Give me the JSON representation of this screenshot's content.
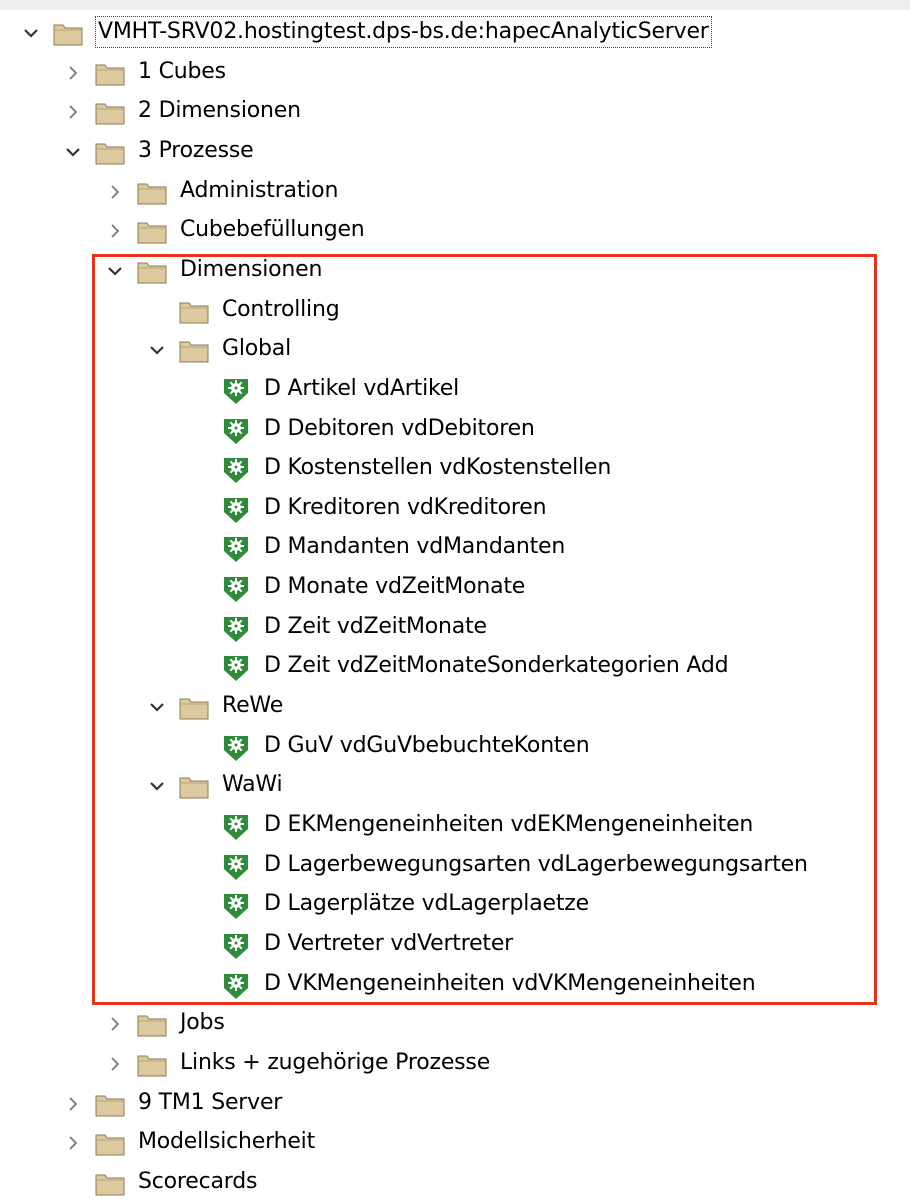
{
  "colors": {
    "highlight": "#e8321c",
    "folder": "#dcc9a0",
    "process": "#2e8b3a"
  },
  "tree": [
    {
      "label": "VMHT-SRV02.hostingtest.dps-bs.de:hapecAnalyticServer",
      "level": 0,
      "expander": "expanded",
      "icon": "folder-icon",
      "root": true
    },
    {
      "label": "1 Cubes",
      "level": 1,
      "expander": "collapsed",
      "icon": "folder-icon"
    },
    {
      "label": "2 Dimensionen",
      "level": 1,
      "expander": "collapsed",
      "icon": "folder-icon"
    },
    {
      "label": "3 Prozesse",
      "level": 1,
      "expander": "expanded",
      "icon": "folder-icon"
    },
    {
      "label": "Administration",
      "level": 2,
      "expander": "collapsed",
      "icon": "folder-icon"
    },
    {
      "label": "Cubebefüllungen",
      "level": 2,
      "expander": "collapsed",
      "icon": "folder-icon"
    },
    {
      "label": "Dimensionen",
      "level": 2,
      "expander": "expanded",
      "icon": "folder-icon"
    },
    {
      "label": "Controlling",
      "level": 3,
      "expander": "none",
      "icon": "folder-icon"
    },
    {
      "label": "Global",
      "level": 3,
      "expander": "expanded",
      "icon": "folder-icon"
    },
    {
      "label": "D Artikel vdArtikel",
      "level": 4,
      "expander": "none",
      "icon": "process-icon"
    },
    {
      "label": "D Debitoren vdDebitoren",
      "level": 4,
      "expander": "none",
      "icon": "process-icon"
    },
    {
      "label": "D Kostenstellen vdKostenstellen",
      "level": 4,
      "expander": "none",
      "icon": "process-icon"
    },
    {
      "label": "D Kreditoren vdKreditoren",
      "level": 4,
      "expander": "none",
      "icon": "process-icon"
    },
    {
      "label": "D Mandanten vdMandanten",
      "level": 4,
      "expander": "none",
      "icon": "process-icon"
    },
    {
      "label": "D Monate vdZeitMonate",
      "level": 4,
      "expander": "none",
      "icon": "process-icon"
    },
    {
      "label": "D Zeit vdZeitMonate",
      "level": 4,
      "expander": "none",
      "icon": "process-icon"
    },
    {
      "label": "D Zeit vdZeitMonateSonderkategorien Add",
      "level": 4,
      "expander": "none",
      "icon": "process-icon"
    },
    {
      "label": "ReWe",
      "level": 3,
      "expander": "expanded",
      "icon": "folder-icon"
    },
    {
      "label": "D GuV vdGuVbebuchteKonten",
      "level": 4,
      "expander": "none",
      "icon": "process-icon"
    },
    {
      "label": "WaWi",
      "level": 3,
      "expander": "expanded",
      "icon": "folder-icon"
    },
    {
      "label": "D EKMengeneinheiten vdEKMengeneinheiten",
      "level": 4,
      "expander": "none",
      "icon": "process-icon"
    },
    {
      "label": "D Lagerbewegungsarten vdLagerbewegungsarten",
      "level": 4,
      "expander": "none",
      "icon": "process-icon"
    },
    {
      "label": "D Lagerplätze vdLagerplaetze",
      "level": 4,
      "expander": "none",
      "icon": "process-icon"
    },
    {
      "label": "D Vertreter vdVertreter",
      "level": 4,
      "expander": "none",
      "icon": "process-icon"
    },
    {
      "label": "D VKMengeneinheiten vdVKMengeneinheiten",
      "level": 4,
      "expander": "none",
      "icon": "process-icon"
    },
    {
      "label": "Jobs",
      "level": 2,
      "expander": "collapsed",
      "icon": "folder-icon"
    },
    {
      "label": "Links + zugehörige Prozesse",
      "level": 2,
      "expander": "collapsed",
      "icon": "folder-icon"
    },
    {
      "label": "9 TM1 Server",
      "level": 1,
      "expander": "collapsed",
      "icon": "folder-icon"
    },
    {
      "label": "Modellsicherheit",
      "level": 1,
      "expander": "collapsed",
      "icon": "folder-icon"
    },
    {
      "label": "Scorecards",
      "level": 1,
      "expander": "none",
      "icon": "folder-icon"
    }
  ]
}
